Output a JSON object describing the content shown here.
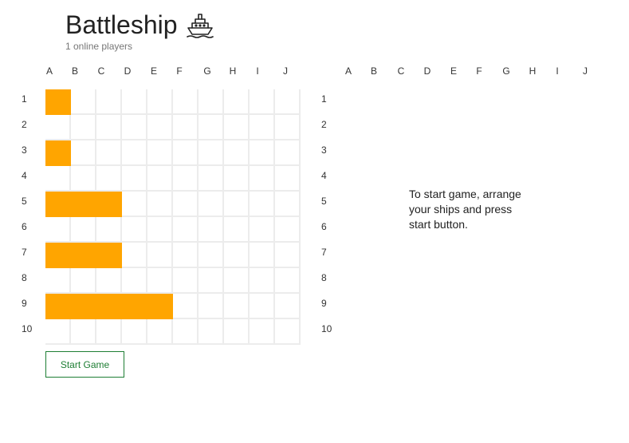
{
  "header": {
    "title": "Battleship",
    "ship_icon": "ship-icon",
    "online_players": "1 online players"
  },
  "board": {
    "columns": [
      "A",
      "B",
      "C",
      "D",
      "E",
      "F",
      "G",
      "H",
      "I",
      "J"
    ],
    "rows": [
      "1",
      "2",
      "3",
      "4",
      "5",
      "6",
      "7",
      "8",
      "9",
      "10"
    ],
    "ships": [
      {
        "row": 1,
        "col": "A",
        "length": 1
      },
      {
        "row": 3,
        "col": "A",
        "length": 1
      },
      {
        "row": 5,
        "col": "A",
        "length": 3
      },
      {
        "row": 7,
        "col": "A",
        "length": 3
      },
      {
        "row": 9,
        "col": "A",
        "length": 5
      }
    ],
    "ship_color": "#ffa500"
  },
  "opponent_board": {
    "columns": [
      "A",
      "B",
      "C",
      "D",
      "E",
      "F",
      "G",
      "H",
      "I",
      "J"
    ],
    "rows": [
      "1",
      "2",
      "3",
      "4",
      "5",
      "6",
      "7",
      "8",
      "9",
      "10"
    ],
    "message": "To start game, arrange your ships and press start button."
  },
  "actions": {
    "start_label": "Start Game",
    "accent": "#1e7e34"
  }
}
